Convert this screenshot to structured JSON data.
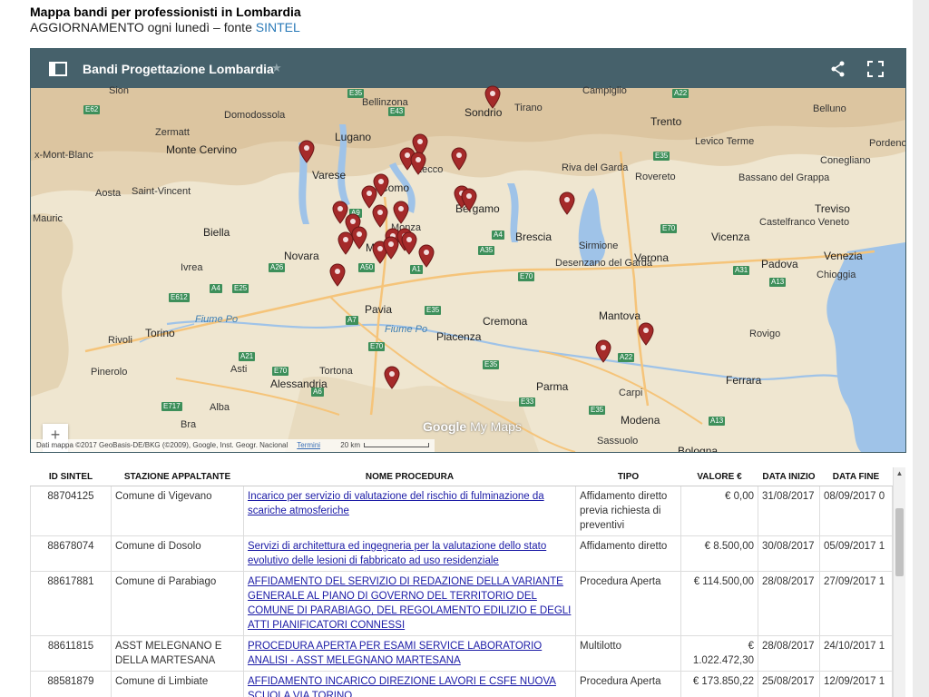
{
  "page": {
    "title": "Mappa bandi per professionisti in Lombardia",
    "subtitle_prefix": "AGGIORNAMENTO ogni lunedì – fonte ",
    "subtitle_link": "SINTEL"
  },
  "map": {
    "title": "Bandi Progettazione Lombardia",
    "icons": [
      "sidebar-toggle-icon",
      "star-icon",
      "share-icon",
      "fullscreen-icon",
      "map-pin-icon"
    ],
    "pin_color": "#a52a2a",
    "labels": [
      "Sion",
      "Sondrio",
      "Tirano",
      "Campiglio",
      "Belluno",
      "Bellinzona",
      "Domodossola",
      "Zermatt",
      "Monte Cervino",
      "Lugano",
      "Trento",
      "Levico Terme",
      "Pordeno",
      "x-Mont-Blanc",
      "Varese",
      "Como",
      "Lecco",
      "Riva del Garda",
      "Rovereto",
      "Bassano del Grappa",
      "Conegliano",
      "Aosta",
      "Saint-Vincent",
      "Bergamo",
      "Monza",
      "Treviso",
      "Biella",
      "Milano",
      "Brescia",
      "Castelfranco Veneto",
      "Sirmione",
      "Vicenza",
      "Venezia",
      "Novara",
      "Ivrea",
      "Desenzano del Garda",
      "Verona",
      "Padova",
      "Chioggia",
      "Pavia",
      "Cremona",
      "Mantova",
      "Rovigo",
      "Torino",
      "Rivoli",
      "Piacenza",
      "Pinerolo",
      "Asti",
      "Alessandria",
      "Tortona",
      "Parma",
      "Carpi",
      "Ferrara",
      "Modena",
      "Bra",
      "Alba",
      "Sassuolo",
      "Bologna",
      "Fiume Po",
      "Mauric"
    ],
    "roads": [
      "E62",
      "E35",
      "A22",
      "E43",
      "E35",
      "A4",
      "A35",
      "E70",
      "A26",
      "A50",
      "E25",
      "A4",
      "A1",
      "E70",
      "A31",
      "A13",
      "E612",
      "A7",
      "E35",
      "E70",
      "A22",
      "A21",
      "E35",
      "E33",
      "E717",
      "A13",
      "E70",
      "E35",
      "A9",
      "A6"
    ],
    "google_text": "Google",
    "mymaps_text": "My Maps",
    "attribution": "Dati mappa ©2017 GeoBasis-DE/BKG (©2009), Google, Inst. Geogr. Nacional",
    "terms": "Termini",
    "scale": "20 km",
    "zoom_in": "+",
    "zoom_out": "−"
  },
  "table": {
    "headers": [
      "ID SINTEL",
      "STAZIONE APPALTANTE",
      "NOME PROCEDURA",
      "TIPO",
      "VALORE €",
      "DATA INIZIO",
      "DATA FINE"
    ],
    "rows": [
      {
        "id": "88704125",
        "stazione": "Comune di Vigevano",
        "nome": "Incarico per servizio di valutazione del rischio di fulminazione da scariche atmosferiche",
        "tipo": "Affidamento diretto previa richiesta di preventivi",
        "valore": "€ 0,00",
        "inizio": "31/08/2017",
        "fine": "08/09/2017 0"
      },
      {
        "id": "88678074",
        "stazione": "Comune di Dosolo",
        "nome": "Servizi di architettura ed ingegneria per la valutazione dello stato evolutivo delle lesioni di fabbricato ad uso residenziale",
        "tipo": "Affidamento diretto",
        "valore": "€ 8.500,00",
        "inizio": "30/08/2017",
        "fine": "05/09/2017 1"
      },
      {
        "id": "88617881",
        "stazione": "Comune di Parabiago",
        "nome": "AFFIDAMENTO DEL SERVIZIO DI REDAZIONE DELLA VARIANTE GENERALE AL PIANO DI GOVERNO DEL TERRITORIO DEL COMUNE DI PARABIAGO, DEL REGOLAMENTO EDILIZIO E DEGLI ATTI PIANIFICATORI CONNESSI",
        "tipo": "Procedura Aperta",
        "valore": "€ 114.500,00",
        "inizio": "28/08/2017",
        "fine": "27/09/2017 1"
      },
      {
        "id": "88611815",
        "stazione": "ASST MELEGNANO E DELLA MARTESANA",
        "nome": "PROCEDURA APERTA PER ESAMI SERVICE LABORATORIO ANALISI - ASST MELEGNANO MARTESANA",
        "tipo": "Multilotto",
        "valore": "€ 1.022.472,30",
        "inizio": "28/08/2017",
        "fine": "24/10/2017 1"
      },
      {
        "id": "88581879",
        "stazione": "Comune di Limbiate",
        "nome": "AFFIDAMENTO INCARICO DIREZIONE LAVORI E CSFE NUOVA SCUOLA VIA TORINO",
        "tipo": "Procedura Aperta",
        "valore": "€ 173.850,22",
        "inizio": "25/08/2017",
        "fine": "12/09/2017 1"
      }
    ]
  }
}
